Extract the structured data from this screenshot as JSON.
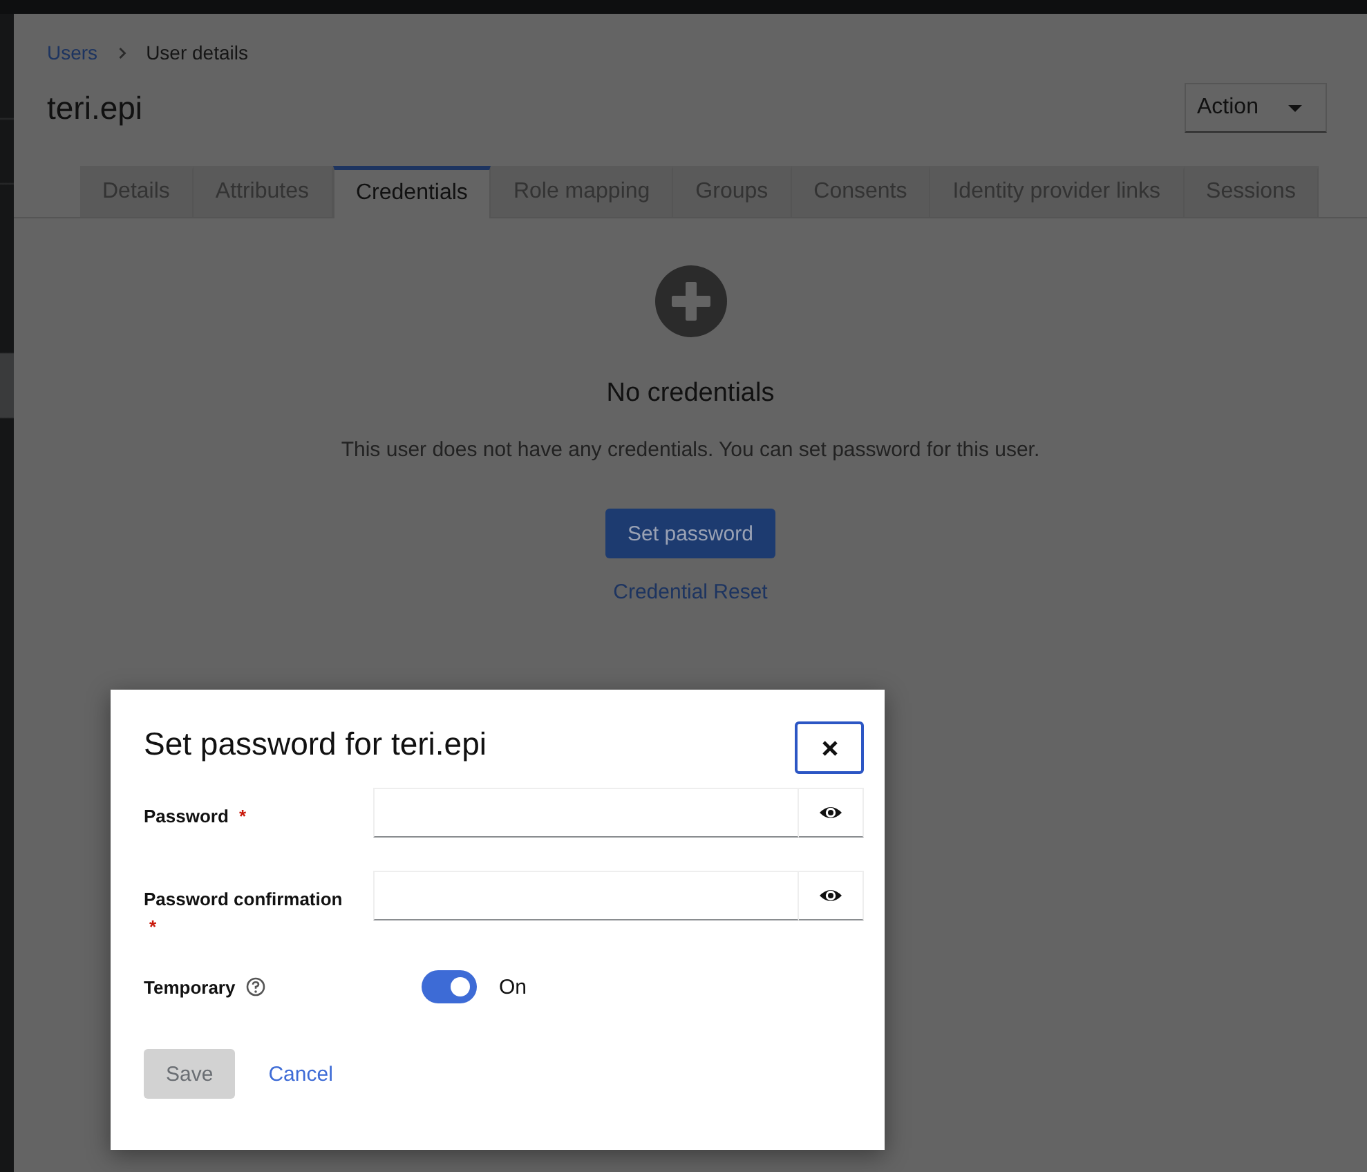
{
  "breadcrumb": [
    {
      "label": "Users",
      "link": true
    },
    {
      "label": "User details",
      "link": false
    }
  ],
  "title": "teri.epi",
  "action_menu": {
    "label": "Action"
  },
  "tabs": [
    {
      "label": "Details",
      "selected": false
    },
    {
      "label": "Attributes",
      "selected": false
    },
    {
      "label": "Credentials",
      "selected": true
    },
    {
      "label": "Role mapping",
      "selected": false
    },
    {
      "label": "Groups",
      "selected": false
    },
    {
      "label": "Consents",
      "selected": false
    },
    {
      "label": "Identity provider links",
      "selected": false
    },
    {
      "label": "Sessions",
      "selected": false
    }
  ],
  "empty_state": {
    "title": "No credentials",
    "body": "This user does not have any credentials. You can set password for this user.",
    "primary_button": "Set password",
    "link": "Credential Reset"
  },
  "dialog": {
    "title": "Set password for teri.epi",
    "fields": [
      {
        "label": "Password",
        "required_mark": "*"
      },
      {
        "label": "Password confirmation",
        "required_mark": "*"
      }
    ],
    "toggle": {
      "label": "Temporary",
      "on": true,
      "status": "On"
    },
    "buttons": [
      {
        "label": "Save",
        "kind": "primary",
        "disabled": true
      },
      {
        "label": "Cancel",
        "kind": "link",
        "disabled": false
      }
    ]
  }
}
